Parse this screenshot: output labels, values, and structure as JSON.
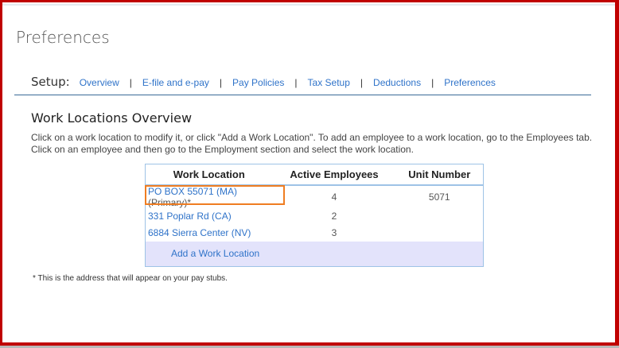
{
  "page": {
    "title": "Preferences"
  },
  "setup_nav": {
    "label": "Setup:",
    "items": [
      "Overview",
      "E-file and e-pay",
      "Pay Policies",
      "Tax Setup",
      "Deductions",
      "Preferences"
    ],
    "separator": "|"
  },
  "section": {
    "title": "Work Locations Overview",
    "description": "Click on a work location to modify it, or click \"Add a Work Location\". To add an employee to a work location, go to the Employees tab. Click on an employee and then go to the Employment section and select the work location."
  },
  "table": {
    "headers": [
      "Work Location",
      "Active Employees",
      "Unit Number"
    ],
    "rows": [
      {
        "location": "PO BOX 55071 (MA)",
        "suffix": " (Primary)*",
        "active": "4",
        "unit": "5071"
      },
      {
        "location": "331 Poplar Rd (CA)",
        "suffix": "",
        "active": "2",
        "unit": ""
      },
      {
        "location": "6884 Sierra Center (NV)",
        "suffix": "",
        "active": "3",
        "unit": ""
      }
    ],
    "add_label": "Add a Work Location"
  },
  "footnote": "* This is the address that will appear on your pay stubs.",
  "colors": {
    "link": "#2f73c9",
    "frame": "#c00000",
    "highlight": "#ef7d22"
  }
}
